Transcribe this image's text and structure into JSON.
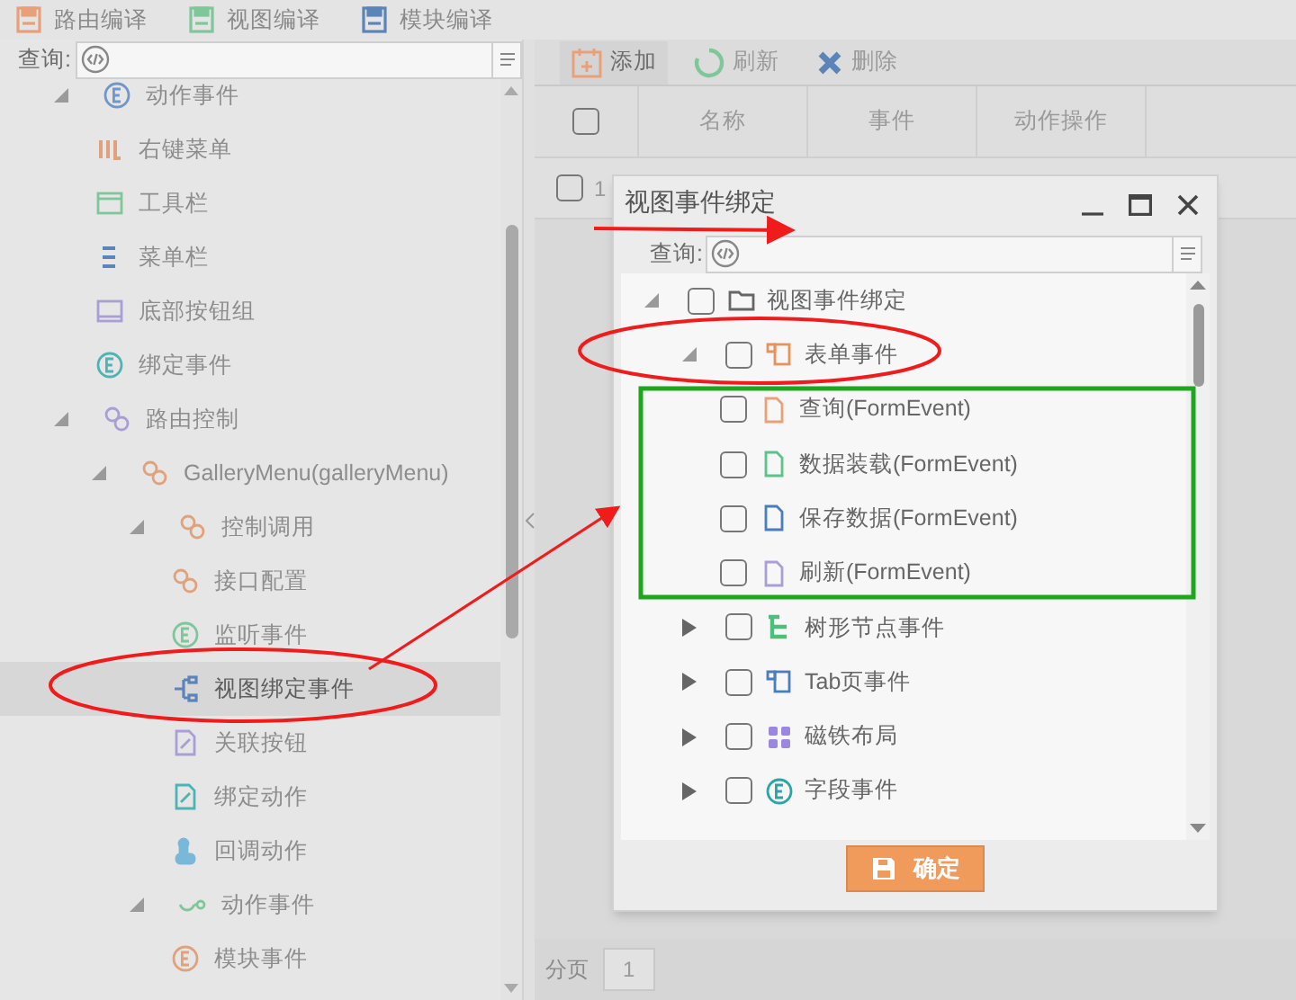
{
  "toolbar": [
    {
      "label": "路由编译",
      "color": "#e8a07a"
    },
    {
      "label": "视图编译",
      "color": "#7fc79a"
    },
    {
      "label": "模块编译",
      "color": "#5b84b8"
    }
  ],
  "left_panel": {
    "search_label": "查询:",
    "tree": [
      {
        "label": "动作事件",
        "kind": "event",
        "color": "#6f97c9",
        "expanded": true,
        "selected": false,
        "children": [
          {
            "label": "右键菜单",
            "kind": "bars",
            "color": "#e0a27c",
            "selected": false
          },
          {
            "label": "工具栏",
            "kind": "window",
            "color": "#7fc79a",
            "selected": false
          },
          {
            "label": "菜单栏",
            "kind": "list",
            "color": "#5b84b8",
            "selected": false
          },
          {
            "label": "底部按钮组",
            "kind": "panel",
            "color": "#a99fd6",
            "selected": false
          },
          {
            "label": "绑定事件",
            "kind": "event",
            "color": "#4fb3b3",
            "selected": false
          }
        ]
      },
      {
        "label": "路由控制",
        "kind": "chain",
        "color": "#a99fd6",
        "expanded": true,
        "selected": false,
        "children": [
          {
            "label": "GalleryMenu(galleryMenu)",
            "kind": "chain",
            "color": "#e0a27c",
            "expanded": true,
            "selected": false,
            "children": [
              {
                "label": "控制调用",
                "kind": "chain",
                "color": "#e0a27c",
                "expanded": true,
                "selected": false,
                "children": [
                  {
                    "label": "接口配置",
                    "kind": "chain",
                    "color": "#e0a27c",
                    "selected": false
                  },
                  {
                    "label": "监听事件",
                    "kind": "event",
                    "color": "#7fc79a",
                    "selected": false
                  },
                  {
                    "label": "视图绑定事件",
                    "kind": "nodes",
                    "color": "#5b84b8",
                    "selected": true
                  },
                  {
                    "label": "关联按钮",
                    "kind": "note",
                    "color": "#a99fd6",
                    "selected": false
                  },
                  {
                    "label": "绑定动作",
                    "kind": "note",
                    "color": "#4fb3b3",
                    "selected": false
                  },
                  {
                    "label": "回调动作",
                    "kind": "hand",
                    "color": "#7ab8d9",
                    "selected": false
                  }
                ]
              },
              {
                "label": "动作事件",
                "kind": "plug",
                "color": "#7fc79a",
                "expanded": true,
                "selected": false,
                "children": [
                  {
                    "label": "模块事件",
                    "kind": "event",
                    "color": "#e0a27c",
                    "selected": false
                  }
                ]
              }
            ]
          }
        ]
      }
    ]
  },
  "right_panel": {
    "toolbar": [
      {
        "label": "添加",
        "kind": "add"
      },
      {
        "label": "刷新",
        "kind": "refresh"
      },
      {
        "label": "删除",
        "kind": "delete"
      }
    ],
    "table": {
      "header_checked": false,
      "columns": [
        "名称",
        "事件",
        "动作操作"
      ],
      "rows": [
        {
          "number": "1",
          "checked": false
        }
      ]
    },
    "pager": {
      "label": "分页",
      "page": "1"
    }
  },
  "dialog": {
    "title": "视图事件绑定",
    "search_label": "查询:",
    "tree": [
      {
        "label": "视图事件绑定",
        "kind": "folder",
        "color": "#666666",
        "expanded": true,
        "checked": false,
        "children": [
          {
            "label": "表单事件",
            "kind": "pages",
            "color": "#e8925a",
            "expanded": true,
            "checked": false,
            "children": [
              {
                "label": "查询(FormEvent)",
                "kind": "doc",
                "color": "#e8a07a",
                "checked": false
              },
              {
                "label": "数据装载(FormEvent)",
                "kind": "doc",
                "color": "#5cc48a",
                "checked": false
              },
              {
                "label": "保存数据(FormEvent)",
                "kind": "doc",
                "color": "#4a7cc0",
                "checked": false
              },
              {
                "label": "刷新(FormEvent)",
                "kind": "doc",
                "color": "#a99fd6",
                "checked": false
              }
            ]
          },
          {
            "label": "树形节点事件",
            "kind": "tree",
            "color": "#4cc07a",
            "expanded": false,
            "checked": false
          },
          {
            "label": "Tab页事件",
            "kind": "pages",
            "color": "#4a7cc0",
            "expanded": false,
            "checked": false
          },
          {
            "label": "磁铁布局",
            "kind": "grid",
            "color": "#9b86e0",
            "expanded": false,
            "checked": false
          },
          {
            "label": "字段事件",
            "kind": "event",
            "color": "#2aa5a5",
            "expanded": false,
            "checked": false
          }
        ]
      }
    ],
    "confirm": "确定"
  }
}
